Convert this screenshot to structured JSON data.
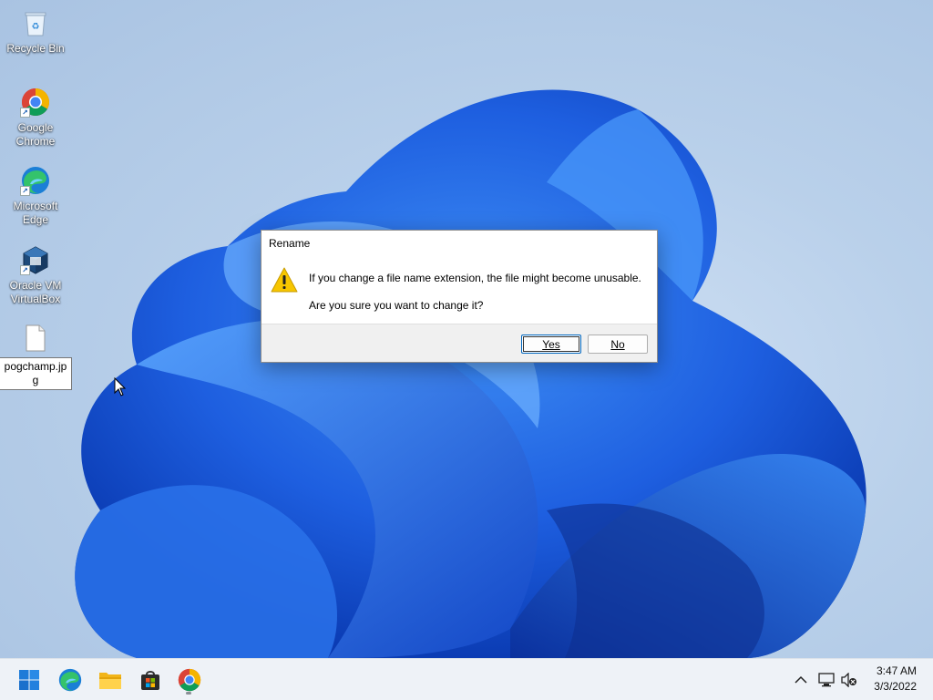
{
  "desktop": {
    "icons": [
      {
        "label": "Recycle Bin",
        "icon": "recycle-bin-icon"
      },
      {
        "label": "Google Chrome",
        "icon": "chrome-icon"
      },
      {
        "label": "Microsoft Edge",
        "icon": "edge-icon"
      },
      {
        "label": "Oracle VM VirtualBox",
        "icon": "virtualbox-icon"
      }
    ],
    "file": {
      "name": "pogchamp.jpg",
      "icon": "file-icon"
    }
  },
  "dialog": {
    "title": "Rename",
    "icon": "warning-icon",
    "message": "If you change a file name extension, the file might become unusable.",
    "question": "Are you sure you want to change it?",
    "yes_label": "Yes",
    "no_label": "No"
  },
  "taskbar": {
    "apps": [
      {
        "name": "Start",
        "icon": "windows-start-icon"
      },
      {
        "name": "Microsoft Edge",
        "icon": "edge-icon"
      },
      {
        "name": "File Explorer",
        "icon": "folder-icon"
      },
      {
        "name": "Microsoft Store",
        "icon": "store-icon"
      },
      {
        "name": "Google Chrome",
        "icon": "chrome-icon",
        "running": true
      }
    ],
    "tray": {
      "icons": [
        "chevron-up-icon",
        "network-icon",
        "volume-muted-icon"
      ],
      "time": "3:47 AM",
      "date": "3/3/2022"
    }
  },
  "colors": {
    "accent": "#0067c0",
    "wallpaper_blue": "#1f63e0",
    "warning_yellow": "#f7c600"
  }
}
